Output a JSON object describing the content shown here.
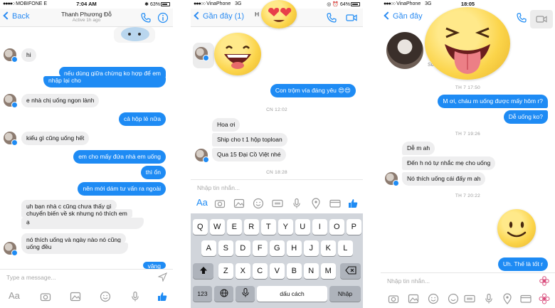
{
  "colors": {
    "accent": "#1e8bf4",
    "bubble_in": "#eeeeef",
    "keyboard": "#d1d5db"
  },
  "phone1": {
    "status": {
      "carrier": "MOBIFONE",
      "network": "E",
      "time": "7:04 AM",
      "battery": "63%"
    },
    "nav": {
      "back": "Back",
      "title": "Thanh Phương Đỗ",
      "subtitle": "Active 1h ago"
    },
    "messages": [
      {
        "from": "them",
        "text": "hi"
      },
      {
        "from": "me",
        "text": "nếu dùng giữa chừng ko hợp để em"
      },
      {
        "from": "me",
        "text": "nhập lại cho"
      },
      {
        "from": "them",
        "text": "e nhà chị uống ngon lành"
      },
      {
        "from": "me",
        "text": "cả hộp lẻ nữa"
      },
      {
        "from": "them",
        "text": "kiểu gì cũng uống hết"
      },
      {
        "from": "me",
        "text": "em cho mấy đứa nhà em uống"
      },
      {
        "from": "me",
        "text": "thì ổn"
      },
      {
        "from": "me",
        "text": "nên mới dám tư vấn ra ngoài"
      },
      {
        "from": "them",
        "text": "uh bạn nhà c cũng chưa thấy gì"
      },
      {
        "from": "them",
        "text": "chuyển biến về sk nhưng nó thích em"
      },
      {
        "from": "them",
        "text": "ạ"
      },
      {
        "from": "them",
        "text": "nó thích uống và ngày nào nó cũng"
      },
      {
        "from": "them",
        "text": "uống đều"
      },
      {
        "from": "me",
        "text": "vâng"
      }
    ],
    "composer_placeholder": "Type a message...",
    "toolbar_text_icon": "Aa"
  },
  "phone2": {
    "status": {
      "carrier": "VinaPhone",
      "network": "3G",
      "battery": "64%"
    },
    "nav": {
      "back": "Gần đây (1)",
      "title": "H"
    },
    "messages": [
      {
        "from": "me",
        "text": "Con trộm vía đáng yêu 😍😍"
      },
      {
        "from": "them",
        "text": "Hoa ơi"
      },
      {
        "from": "them",
        "text": "Ship cho t 1 hộp toploan"
      },
      {
        "from": "them",
        "text": "Qua 15 Đại Cồ Việt nhé"
      }
    ],
    "separators": [
      "CN 12:02",
      "CN 18:28"
    ],
    "composer_placeholder": "Nhập tin nhắn...",
    "toolbar_text_icon": "Aa",
    "keyboard": {
      "row1": [
        "Q",
        "W",
        "E",
        "R",
        "T",
        "Y",
        "U",
        "I",
        "O",
        "P"
      ],
      "row2": [
        "A",
        "S",
        "D",
        "F",
        "G",
        "H",
        "J",
        "K",
        "L"
      ],
      "row3": [
        "Z",
        "X",
        "C",
        "V",
        "B",
        "N",
        "M"
      ],
      "numbers": "123",
      "space": "dấu cách",
      "return": "Nhập"
    }
  },
  "phone3": {
    "status": {
      "carrier": "VinaPhone",
      "network": "3G",
      "time": "18:05"
    },
    "nav": {
      "back": "Gần đây"
    },
    "profile": {
      "n1": "k",
      "line2": "L",
      "line3": "Số"
    },
    "messages": [
      {
        "from": "me",
        "text": "M ơi, cháu m uống được mấy hôm r?"
      },
      {
        "from": "me",
        "text": "Dễ uống ko?"
      },
      {
        "from": "them",
        "text": "Dễ m ah"
      },
      {
        "from": "them",
        "text": "Đến h nó tự nhắc mẹ cho uống"
      },
      {
        "from": "them",
        "text": "Nó thích uống cái đấy m ah"
      },
      {
        "from": "me",
        "text": "Uh. Thế là tốt r"
      }
    ],
    "separators": [
      "TH 7 17:50",
      "TH 7 19:26",
      "TH 7 20:22"
    ],
    "composer_placeholder": "Nhập tin nhắn..."
  }
}
